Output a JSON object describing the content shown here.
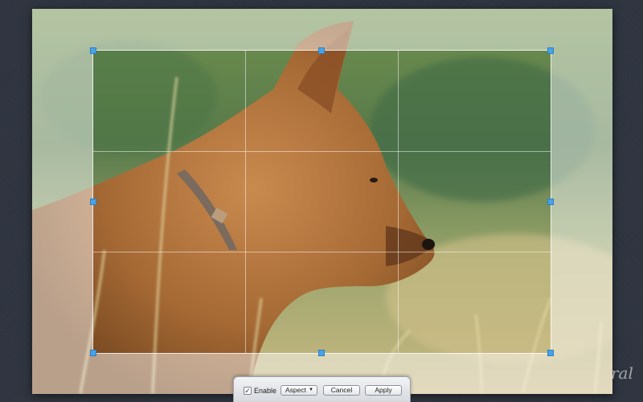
{
  "photo": {
    "subject": "dog-profile-photo"
  },
  "toolbar": {
    "enable_label": "Enable",
    "enable_checked": "✓",
    "aspect_label": "Aspect",
    "aspect_arrow": "▼",
    "cancel_label": "Cancel",
    "apply_label": "Apply"
  },
  "watermark": {
    "text": "ral"
  },
  "colors": {
    "handle": "#4aa3e6",
    "background": "#2f3540"
  }
}
